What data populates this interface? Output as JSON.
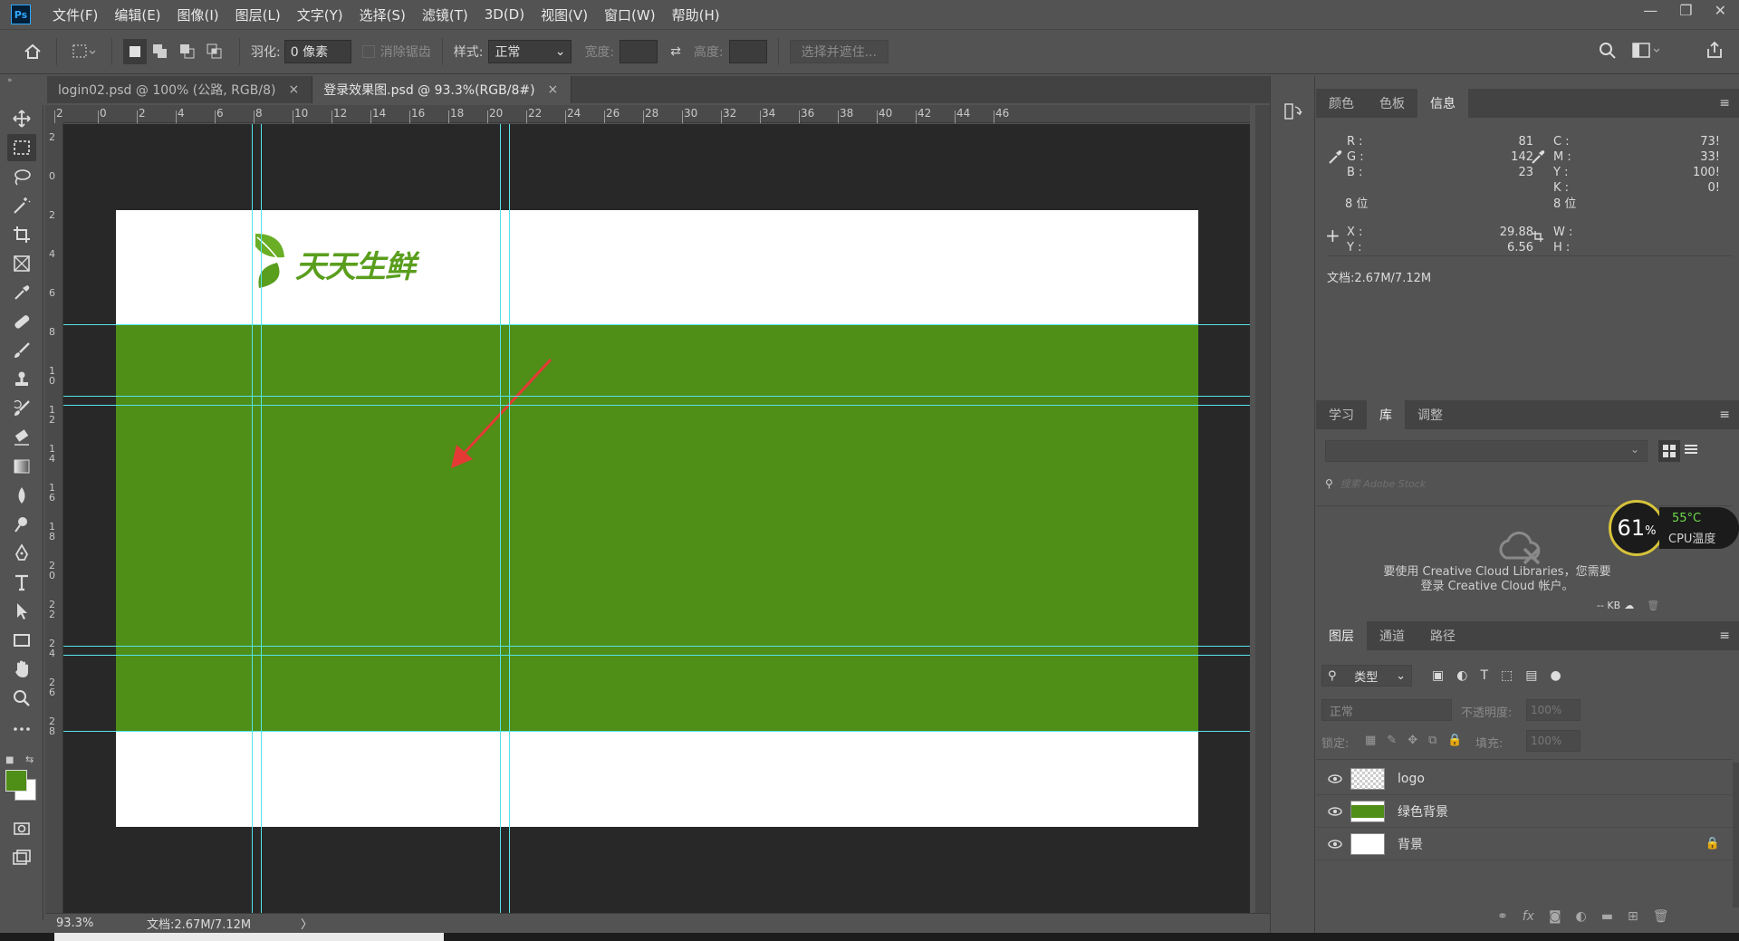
{
  "app": {
    "logo_text": "Ps"
  },
  "menu": [
    "文件(F)",
    "编辑(E)",
    "图像(I)",
    "图层(L)",
    "文字(Y)",
    "选择(S)",
    "滤镜(T)",
    "3D(D)",
    "视图(V)",
    "窗口(W)",
    "帮助(H)"
  ],
  "options": {
    "feather_label": "羽化:",
    "feather_value": "0 像素",
    "antialias_label": "消除锯齿",
    "style_label": "样式:",
    "style_value": "正常",
    "width_label": "宽度:",
    "height_label": "高度:",
    "select_mask_label": "选择并遮住..."
  },
  "tabs": [
    {
      "label": "login02.psd @ 100% (公路, RGB/8)",
      "close": "×"
    },
    {
      "label": "登录效果图.psd @ 93.3%(RGB/8#)",
      "close": "×"
    }
  ],
  "ruler_top": [
    "2",
    "0",
    "2",
    "4",
    "6",
    "8",
    "10",
    "12",
    "14",
    "16",
    "18",
    "20",
    "22",
    "24",
    "26",
    "28",
    "30",
    "32",
    "34",
    "36",
    "38",
    "40",
    "42",
    "44",
    "46"
  ],
  "ruler_left": [
    "2",
    "0",
    "2",
    "4",
    "6",
    "8",
    "1\n0",
    "1\n2",
    "1\n4",
    "1\n6",
    "1\n8",
    "2\n0",
    "2\n2",
    "2\n4",
    "2\n6",
    "2\n8"
  ],
  "canvas": {
    "logo_text": "天天生鲜",
    "doc_bg": "#ffffff",
    "band_color": "#4f8e17",
    "guide_color": "#57e3ea",
    "arrow_color": "#e53935"
  },
  "status": {
    "zoom": "93.3%",
    "doc": "文档:2.67M/7.12M",
    "arrow": "〉"
  },
  "panel_top": {
    "tabs": [
      "颜色",
      "色板",
      "信息"
    ],
    "active": 2,
    "rgb": {
      "r_label": "R :",
      "g_label": "G :",
      "b_label": "B :",
      "r": "81",
      "g": "142",
      "b": "23",
      "bits": "8 位"
    },
    "cmyk": {
      "c_label": "C :",
      "m_label": "M :",
      "y_label": "Y :",
      "k_label": "K :",
      "c": "73!",
      "m": "33!",
      "y": "100!",
      "k": "0!",
      "bits": "8 位"
    },
    "xy": {
      "x_label": "X :",
      "y_label": "Y :",
      "x": "29.88",
      "y": "6.56"
    },
    "wh": {
      "w_label": "W :",
      "h_label": "H :"
    },
    "doc": "文档:2.67M/7.12M"
  },
  "panel_mid": {
    "tabs": [
      "学习",
      "库",
      "调整"
    ],
    "active": 1,
    "search_placeholder": "搜索 Adobe Stock",
    "cc_message_1": "要使用 Creative Cloud Libraries，您需要",
    "cc_message_2": "登录 Creative Cloud 帐户。",
    "kb": "-- KB"
  },
  "cpu": {
    "percent": "61",
    "unit": "%",
    "temp": "55°C",
    "label": "CPU温度"
  },
  "panel_layers": {
    "tabs": [
      "图层",
      "通道",
      "路径"
    ],
    "active": 0,
    "filter_label": "类型",
    "blend_mode": "正常",
    "opacity_label": "不透明度:",
    "opacity_value": "100%",
    "lock_label": "锁定:",
    "fill_label": "填充:",
    "fill_value": "100%",
    "layers": [
      {
        "name": "logo",
        "thumb": "transparent"
      },
      {
        "name": "绿色背景",
        "thumb": "#4f8e17"
      },
      {
        "name": "背景",
        "thumb": "#ffffff",
        "locked": true
      }
    ]
  }
}
